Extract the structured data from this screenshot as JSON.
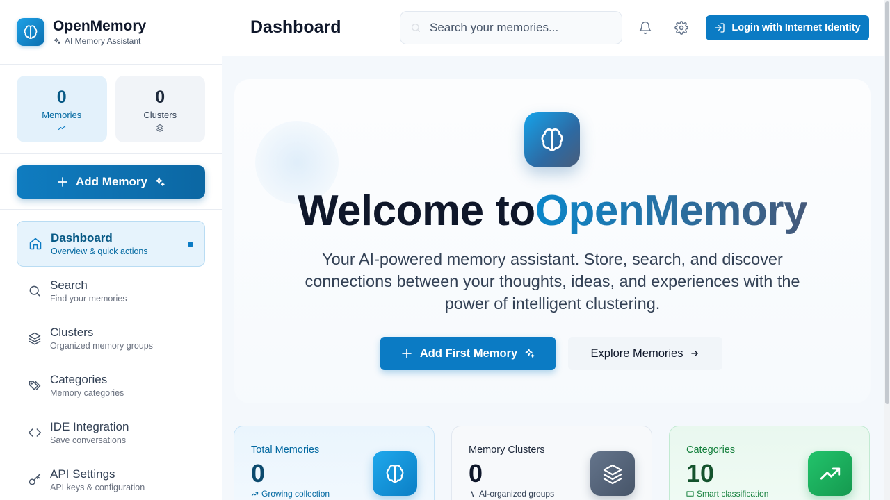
{
  "brand": {
    "name": "OpenMemory",
    "subtitle": "AI Memory Assistant"
  },
  "sidebar": {
    "stats": [
      {
        "value": "0",
        "label": "Memories",
        "icon": "trending-up-icon"
      },
      {
        "value": "0",
        "label": "Clusters",
        "icon": "layers-icon"
      }
    ],
    "add_memory_label": "Add Memory",
    "nav": [
      {
        "label": "Dashboard",
        "desc": "Overview & quick actions",
        "icon": "home-icon",
        "active": true
      },
      {
        "label": "Search",
        "desc": "Find your memories",
        "icon": "search-icon"
      },
      {
        "label": "Clusters",
        "desc": "Organized memory groups",
        "icon": "layers-icon"
      },
      {
        "label": "Categories",
        "desc": "Memory categories",
        "icon": "tags-icon"
      },
      {
        "label": "IDE Integration",
        "desc": "Save conversations",
        "icon": "code-icon"
      },
      {
        "label": "API Settings",
        "desc": "API keys & configuration",
        "icon": "key-icon"
      }
    ]
  },
  "header": {
    "title": "Dashboard",
    "search_placeholder": "Search your memories...",
    "login_label": "Login with Internet Identity"
  },
  "hero": {
    "title_prefix": "Welcome to",
    "title_accent": "OpenMemory",
    "description": "Your AI-powered memory assistant. Store, search, and discover connections between your thoughts, ideas, and experiences with the power of intelligent clustering.",
    "primary_cta": "Add First Memory",
    "secondary_cta": "Explore Memories"
  },
  "cards": [
    {
      "title": "Total Memories",
      "value": "0",
      "sub": "Growing collection",
      "icon": "brain-icon"
    },
    {
      "title": "Memory Clusters",
      "value": "0",
      "sub": "AI-organized groups",
      "icon": "layers-icon"
    },
    {
      "title": "Categories",
      "value": "10",
      "sub": "Smart classification",
      "icon": "trending-up-icon"
    }
  ],
  "colors": {
    "primary": "#0b7bc4",
    "green": "#15994f",
    "slate": "#475569"
  }
}
